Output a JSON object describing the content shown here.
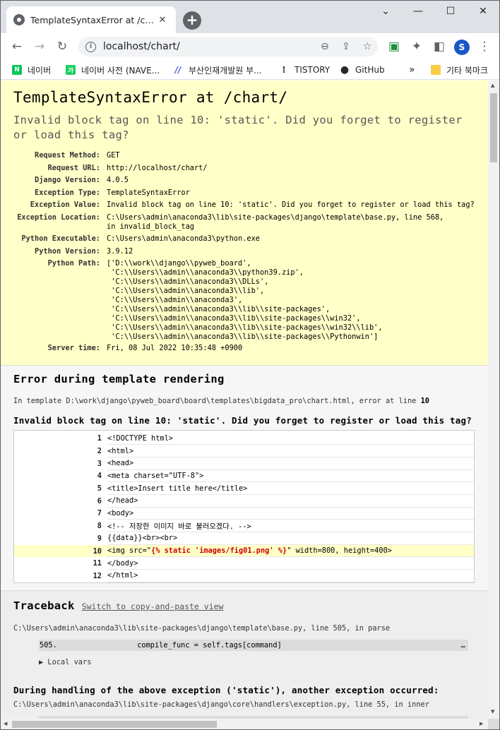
{
  "browser": {
    "tab_title": "TemplateSyntaxError at /chart/",
    "tab_close": "✕",
    "newtab": "+",
    "controls": {
      "dropdown": "⌄",
      "minimize": "—",
      "maximize": "☐",
      "close": "✕"
    },
    "nav": {
      "back": "←",
      "forward": "→",
      "reload": "↻"
    },
    "url": "localhost/chart/",
    "info": "i",
    "omni_actions": {
      "zoom": "⊖",
      "share": "⇪",
      "star": "☆"
    },
    "ext_icons": {
      "ext1": "▣",
      "puzzle": "✦",
      "sidepanel": "◧",
      "menu": "⋮"
    },
    "avatar": "S"
  },
  "bookmarks": [
    {
      "label": "네이버",
      "icon": "N",
      "color": "#03c75a"
    },
    {
      "label": "네이버 사전 (NAVE...",
      "icon": "가",
      "color": "#19ce60"
    },
    {
      "label": "부산인재개발원 부...",
      "icon": "//",
      "color": "#4a5bd4"
    },
    {
      "label": "TISTORY",
      "icon": "⁞",
      "color": "#333333"
    },
    {
      "label": "GitHub",
      "icon": "●",
      "color": "#24292e"
    }
  ],
  "bookmarks_more": "»",
  "bookmarks_other": "기타 북마크",
  "summary": {
    "title": "TemplateSyntaxError at /chart/",
    "subtitle": "Invalid block tag on line 10: 'static'. Did you forget to register or load this tag?",
    "meta": [
      {
        "key": "Request Method:",
        "value": "GET"
      },
      {
        "key": "Request URL:",
        "value": "http://localhost/chart/"
      },
      {
        "key": "Django Version:",
        "value": "4.0.5"
      },
      {
        "key": "Exception Type:",
        "value": "TemplateSyntaxError"
      },
      {
        "key": "Exception Value:",
        "value": "Invalid block tag on line 10: 'static'. Did you forget to register or load this tag?"
      },
      {
        "key": "Exception Location:",
        "value": "C:\\Users\\admin\\anaconda3\\lib\\site-packages\\django\\template\\base.py, line 568,\nin invalid_block_tag"
      },
      {
        "key": "Python Executable:",
        "value": "C:\\Users\\admin\\anaconda3\\python.exe"
      },
      {
        "key": "Python Version:",
        "value": "3.9.12"
      },
      {
        "key": "Python Path:",
        "value": "['D:\\\\work\\\\django\\\\pyweb_board',\n 'C:\\\\Users\\\\admin\\\\anaconda3\\\\python39.zip',\n 'C:\\\\Users\\\\admin\\\\anaconda3\\\\DLLs',\n 'C:\\\\Users\\\\admin\\\\anaconda3\\\\lib',\n 'C:\\\\Users\\\\admin\\\\anaconda3',\n 'C:\\\\Users\\\\admin\\\\anaconda3\\\\lib\\\\site-packages',\n 'C:\\\\Users\\\\admin\\\\anaconda3\\\\lib\\\\site-packages\\\\win32',\n 'C:\\\\Users\\\\admin\\\\anaconda3\\\\lib\\\\site-packages\\\\win32\\\\lib',\n 'C:\\\\Users\\\\admin\\\\anaconda3\\\\lib\\\\site-packages\\\\Pythonwin']"
      },
      {
        "key": "Server time:",
        "value": "Fri, 08 Jul 2022 10:35:48 +0900"
      }
    ]
  },
  "template": {
    "heading": "Error during template rendering",
    "path_prefix": "In template ",
    "path": "D:\\work\\django\\pyweb_board\\board\\templates\\bigdata_pro\\chart.html",
    "path_suffix": ", error at line ",
    "error_line": "10",
    "message": "Invalid block tag on line 10: 'static'. Did you forget to register or load this tag?",
    "lines": [
      {
        "num": "1",
        "code": "<!DOCTYPE html>"
      },
      {
        "num": "2",
        "code": "<html>"
      },
      {
        "num": "3",
        "code": "<head>"
      },
      {
        "num": "4",
        "code": "<meta charset=\"UTF-8\">"
      },
      {
        "num": "5",
        "code": "<title>Insert title here</title>"
      },
      {
        "num": "6",
        "code": "</head>"
      },
      {
        "num": "7",
        "code": "<body>"
      },
      {
        "num": "8",
        "code": "<!-- 저장한 이미지 바로 불러오겠다. -->"
      },
      {
        "num": "9",
        "code": "{{data}}<br><br>"
      },
      {
        "num": "10",
        "code_before": "<img src=\"",
        "code_tag": "{% static 'images/fig01.png' %}",
        "code_after": "\" width=800, height=400>"
      },
      {
        "num": "11",
        "code": "</body>"
      },
      {
        "num": "12",
        "code": "</html>"
      }
    ]
  },
  "traceback": {
    "heading": "Traceback",
    "switch_link": "Switch to copy-and-paste view",
    "frame1_path": "C:\\Users\\admin\\anaconda3\\lib\\site-packages\\django\\template\\base.py, line 505, in parse",
    "frame1_num": "505.",
    "frame1_code": "                compile_func = self.tags[command]",
    "frame1_ellipsis": "…",
    "local_vars": "▶ Local vars",
    "during": "During handling of the above exception ('static'), another exception occurred:",
    "frame2_path": "C:\\Users\\admin\\anaconda3\\lib\\site-packages\\django\\core\\handlers\\exception.py, line 55, in inner"
  },
  "scroll": {
    "up": "▲",
    "down": "▼",
    "left": "◀",
    "right": "▶"
  }
}
